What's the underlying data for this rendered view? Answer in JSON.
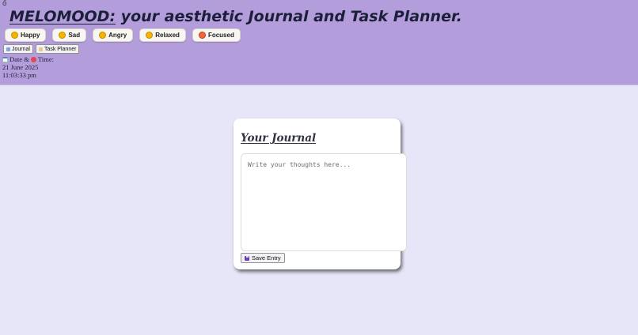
{
  "header": {
    "corner_glyph": "ő",
    "brand": "MELOMOOD:",
    "tagline": " your aesthetic Journal and Task Planner."
  },
  "moods": [
    {
      "icon": "grinning-face-icon",
      "label": "Happy"
    },
    {
      "icon": "sad-face-icon",
      "label": "Sad"
    },
    {
      "icon": "angry-face-icon",
      "label": "Angry"
    },
    {
      "icon": "relieved-face-icon",
      "label": "Relaxed"
    },
    {
      "icon": "focused-face-icon",
      "label": "Focused"
    }
  ],
  "tabs": [
    {
      "icon": "notebook-icon",
      "label": "Journal"
    },
    {
      "icon": "notepad-icon",
      "label": "Task Planner"
    }
  ],
  "datetime": {
    "label_date": "Date & ",
    "label_time": "Time:",
    "date": "21 June 2025",
    "time": "11:03:33 pm"
  },
  "journal": {
    "title": "Your Journal",
    "placeholder": "Write your thoughts here...",
    "value": "",
    "save_label": "Save Entry",
    "save_icon": "floppy-disk-icon"
  },
  "colors": {
    "header_bg": "#b39ddb",
    "page_bg": "#e6e6f8",
    "card_bg": "#ffffff",
    "title_text": "#1b1f3a"
  }
}
